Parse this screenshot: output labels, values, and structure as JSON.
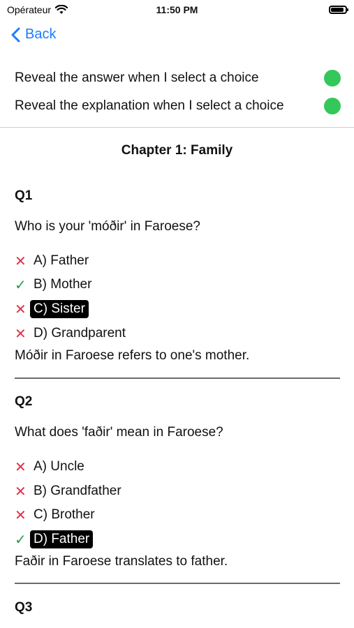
{
  "status": {
    "carrier": "Opérateur",
    "time": "11:50 PM"
  },
  "nav": {
    "back_label": "Back"
  },
  "settings": {
    "reveal_answer_label": "Reveal the answer when I select a choice",
    "reveal_explanation_label": "Reveal the explanation when I select a choice",
    "toggle_color": "#34c759"
  },
  "chapter_title": "Chapter 1: Family",
  "questions": [
    {
      "title": "Q1",
      "text": "Who is your 'móðir' in Faroese?",
      "choices": [
        {
          "label": "A) Father",
          "mark": "x"
        },
        {
          "label": "B) Mother",
          "mark": "ok"
        },
        {
          "label": "C) Sister",
          "mark": "x",
          "selected": true
        },
        {
          "label": "D) Grandparent",
          "mark": "x"
        }
      ],
      "explanation": "Móðir in Faroese refers to one's mother."
    },
    {
      "title": "Q2",
      "text": "What does 'faðir' mean in Faroese?",
      "choices": [
        {
          "label": "A) Uncle",
          "mark": "x"
        },
        {
          "label": "B) Grandfather",
          "mark": "x"
        },
        {
          "label": "C) Brother",
          "mark": "x"
        },
        {
          "label": "D) Father",
          "mark": "ok",
          "selected": true
        }
      ],
      "explanation": "Faðir in Faroese translates to father."
    },
    {
      "title": "Q3"
    }
  ],
  "colors": {
    "accent": "#1b7cff",
    "wrong": "#e0314a",
    "correct": "#2a9a4d"
  }
}
